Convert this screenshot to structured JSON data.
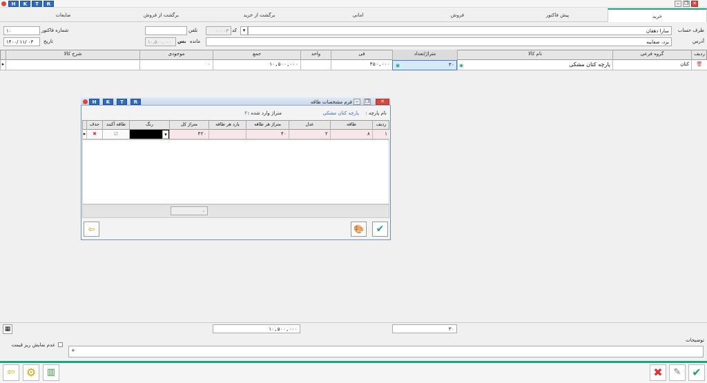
{
  "titlebar": {
    "hk_buttons": [
      "H",
      "K",
      "T",
      "R"
    ]
  },
  "tabs": [
    "خرید",
    "پیش فاکتور",
    "فروش",
    "امانی",
    "برگشت از خرید",
    "برگشت از فروش",
    "ضایعات"
  ],
  "form": {
    "account_label": "طرف حساب",
    "account_value": "سارا دهقان",
    "code_label": "کد",
    "code_value": "۰۰۰۰۳",
    "phone_label": "تلفن",
    "phone_value": "",
    "invoice_no_label": "شماره فاکتور",
    "invoice_no_value": "۱۰",
    "address_label": "آدرس",
    "address_value": "یزد، صفاییه",
    "balance_label": "مانده",
    "balance_value": "۱۰,۵۰۰,۰۰۰",
    "balance_flag": "بس",
    "date_label": "تاریخ",
    "date_value": "۱۴۰۰/ ۱۱/ ۰۳"
  },
  "grid": {
    "headers": [
      "ردیف",
      "گروه فرعی",
      "نام کالا",
      "متراژ/تعداد",
      "فی",
      "واحد",
      "جمع",
      "موجودی",
      "شرح کالا"
    ],
    "row": {
      "group": "کتان",
      "product": "پارچه کتان مشکی",
      "meter": "۳۰",
      "price": "۳۵۰,۰۰۰",
      "unit": "",
      "sum": "۱۰,۵۰۰,۰۰۰",
      "stock": "۰",
      "desc": ""
    }
  },
  "popup": {
    "title": "فرم مشخصات طاقه",
    "hk_buttons": [
      "H",
      "K",
      "T",
      "R"
    ],
    "fabric_label": "نام پارچه :",
    "fabric_value": "پارچه کتان مشکی",
    "meter_entered_label": "متراژ وارد شده :",
    "meter_entered_value": "۳۰",
    "headers": [
      "ردیف",
      "طاقه",
      "عدل",
      "متراژ هر طاقه",
      "یارد هر طاقه",
      "متراژ کل",
      "رنگ",
      "طاقه آکبند",
      "حذف"
    ],
    "row": {
      "idx": "۱",
      "roll": "۸",
      "bale": "۲",
      "meter_per_roll": "۴۰",
      "yard_per_roll": "",
      "total_meter": "۳۲۰"
    },
    "footer_total": "۰"
  },
  "totals": {
    "sum": "۱۰,۵۰۰,۰۰۰",
    "meter": "۳۰"
  },
  "notes": {
    "label": "توضیحات",
    "value": "+",
    "checkbox_label": "عدم نمایش ریز قیمت"
  },
  "colors": {
    "accent": "#17a37c",
    "hk": "#2f6cc0",
    "pink_row": "#f7e6ea"
  }
}
